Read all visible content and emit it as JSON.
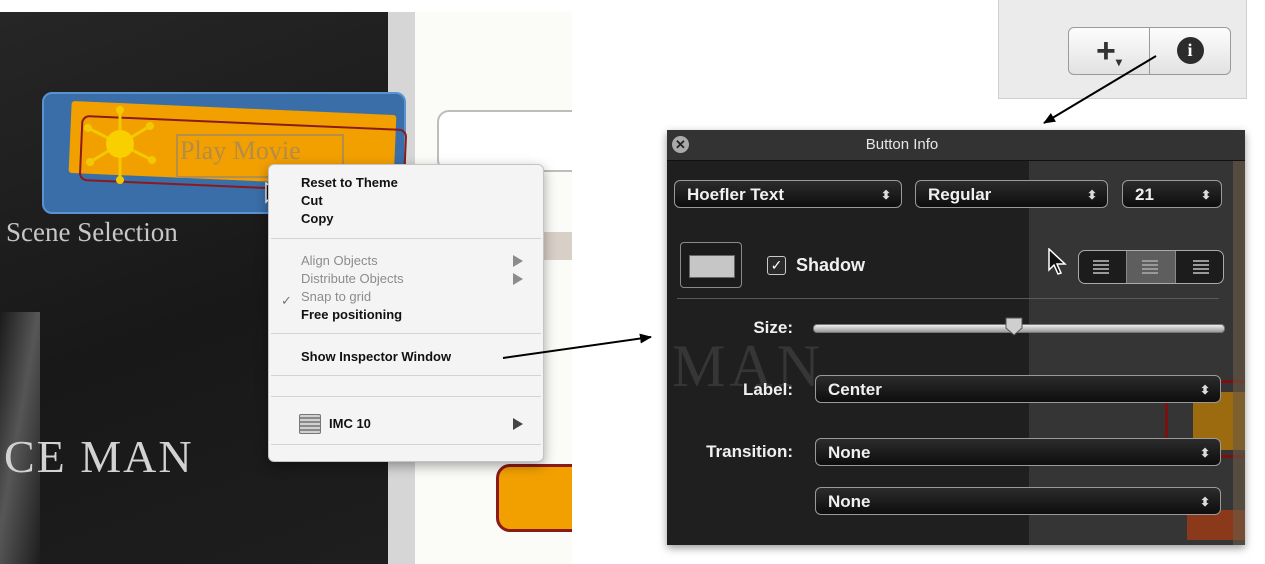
{
  "canvas": {
    "play_movie_label": "Play Movie",
    "scene_selection_label": "Scene Selection",
    "title_fragment": "CE MAN"
  },
  "context_menu": {
    "items": {
      "reset_to_theme": "Reset to Theme",
      "cut": "Cut",
      "copy": "Copy",
      "align_objects": "Align Objects",
      "distribute_objects": "Distribute Objects",
      "snap_to_grid": "Snap to grid",
      "free_positioning": "Free positioning",
      "show_inspector_window": "Show Inspector Window",
      "imc": "IMC 10"
    },
    "snap_to_grid_checked": true
  },
  "toolbar": {
    "add_symbol": "+",
    "add_menu_indicator": "▾",
    "info_symbol": "i"
  },
  "inspector": {
    "title": "Button Info",
    "font_family": "Hoefler Text",
    "font_style": "Regular",
    "font_size": "21",
    "shadow_label": "Shadow",
    "shadow_checked": true,
    "size_label": "Size:",
    "size_slider_value": 0.5,
    "label_label": "Label:",
    "label_value": "Center",
    "transition_label": "Transition:",
    "transition_value": "None",
    "transition_value_2": "None",
    "text_alignment": "center",
    "background_watermark": "MAN"
  },
  "colors": {
    "accent_orange": "#f2a000",
    "selection_blue": "#3a6ea8",
    "outline_red": "#8b1a1a",
    "panel_dark": "#1f1f1f"
  }
}
